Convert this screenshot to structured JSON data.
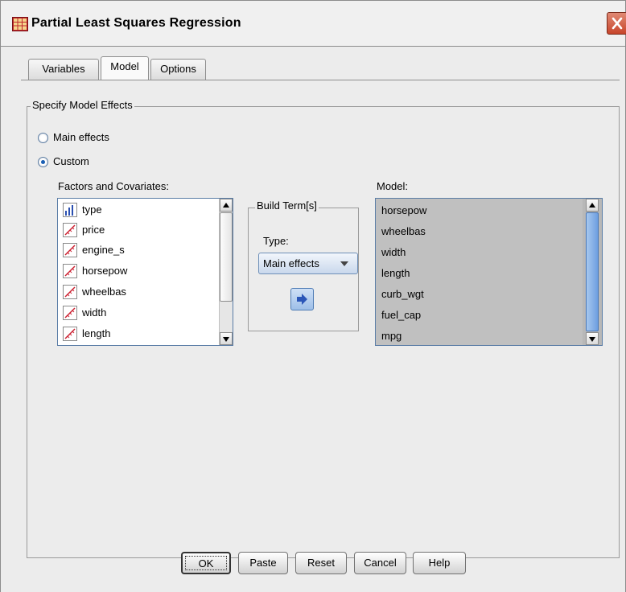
{
  "window": {
    "title": "Partial Least Squares Regression"
  },
  "tabs": [
    {
      "label": "Variables",
      "active": false
    },
    {
      "label": "Model",
      "active": true
    },
    {
      "label": "Options",
      "active": false
    }
  ],
  "model_effects": {
    "group_title": "Specify Model Effects",
    "options": [
      {
        "label": "Main effects",
        "selected": false
      },
      {
        "label": "Custom",
        "selected": true
      }
    ]
  },
  "factors": {
    "label": "Factors and Covariates:",
    "items": [
      {
        "name": "type",
        "icon": "nominal-bars-icon"
      },
      {
        "name": "price",
        "icon": "scale-ruler-icon"
      },
      {
        "name": "engine_s",
        "icon": "scale-ruler-icon"
      },
      {
        "name": "horsepow",
        "icon": "scale-ruler-icon"
      },
      {
        "name": "wheelbas",
        "icon": "scale-ruler-icon"
      },
      {
        "name": "width",
        "icon": "scale-ruler-icon"
      },
      {
        "name": "length",
        "icon": "scale-ruler-icon"
      }
    ]
  },
  "build_terms": {
    "title": "Build Term[s]",
    "type_label": "Type:",
    "type_value": "Main effects"
  },
  "model": {
    "label": "Model:",
    "items": [
      "horsepow",
      "wheelbas",
      "width",
      "length",
      "curb_wgt",
      "fuel_cap",
      "mpg"
    ]
  },
  "buttons": {
    "ok": "OK",
    "paste": "Paste",
    "reset": "Reset",
    "cancel": "Cancel",
    "help": "Help"
  },
  "colors": {
    "close_button": "#c8452b",
    "model_list_bg": "#c0c0c0",
    "accent": "#1a5fb4"
  }
}
